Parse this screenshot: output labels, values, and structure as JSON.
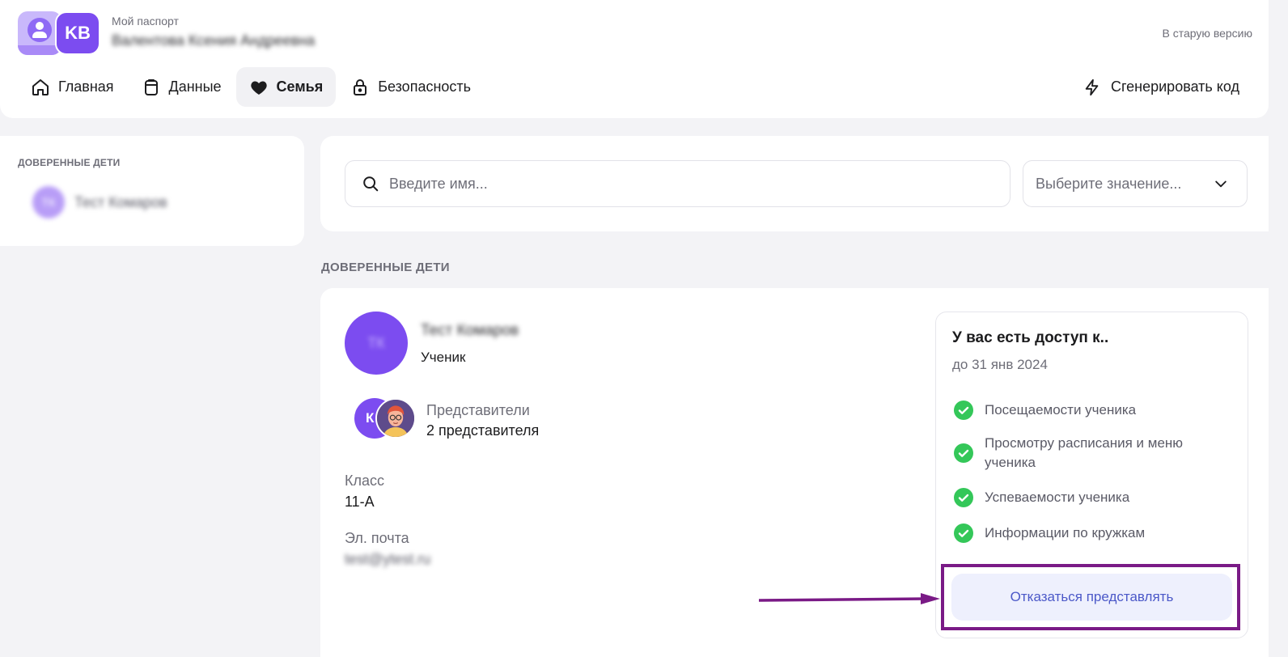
{
  "header": {
    "logo_initials": "KB",
    "passport_label": "Мой паспорт",
    "user_name": "Валентова Ксения Андреевна",
    "old_version_link": "В старую версию",
    "nav": [
      {
        "label": "Главная",
        "icon": "home-icon"
      },
      {
        "label": "Данные",
        "icon": "clipboard-icon"
      },
      {
        "label": "Семья",
        "icon": "heart-icon",
        "active": true
      },
      {
        "label": "Безопасность",
        "icon": "lock-icon"
      }
    ],
    "generate_code": "Сгенерировать код"
  },
  "sidebar": {
    "section_label": "ДОВЕРЕННЫЕ ДЕТИ",
    "child": {
      "initials": "ТК",
      "name": "Тест Комаров"
    }
  },
  "search": {
    "placeholder": "Введите имя...",
    "select_placeholder": "Выберите значение..."
  },
  "section_title": "ДОВЕРЕННЫЕ ДЕТИ",
  "child_card": {
    "avatar_initials": "ТК",
    "name": "Тест Комаров",
    "role": "Ученик",
    "rep_avatar_initial": "К",
    "representatives_label": "Представители",
    "representatives_count": "2 представителя",
    "class_label": "Класс",
    "class_value": "11-А",
    "email_label": "Эл. почта",
    "email_value": "test@ytest.ru",
    "access": {
      "title": "У вас есть доступ к..",
      "until": "до 31 янв 2024",
      "permissions": [
        "Посещаемости ученика",
        "Просмотру расписания и меню ученика",
        "Успеваемости ученика",
        "Информации по кружкам"
      ],
      "refuse_button": "Отказаться представлять"
    }
  },
  "colors": {
    "accent": "#7c4cf0",
    "check_green": "#34c759",
    "highlight": "#7a1a86",
    "button_text": "#4b58c8"
  }
}
